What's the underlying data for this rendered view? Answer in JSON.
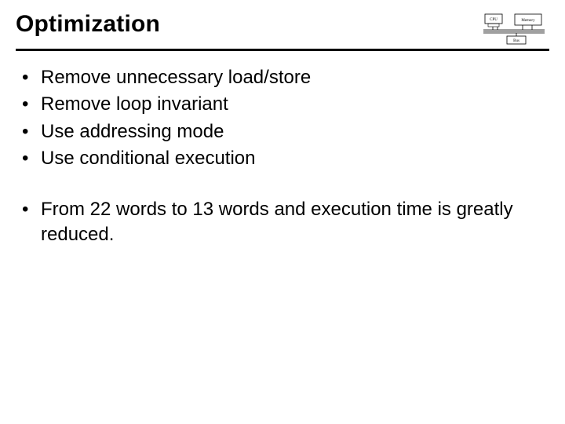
{
  "title": "Optimization",
  "bullets_group1": [
    "Remove unnecessary load/store",
    "Remove loop invariant",
    "Use addressing mode",
    "Use conditional execution"
  ],
  "bullets_group2": [
    "From 22 words to 13 words and execution time is greatly reduced."
  ],
  "diagram": {
    "label_top_left": "CPU",
    "label_top_right": "Memory",
    "label_bottom": "Bus"
  }
}
